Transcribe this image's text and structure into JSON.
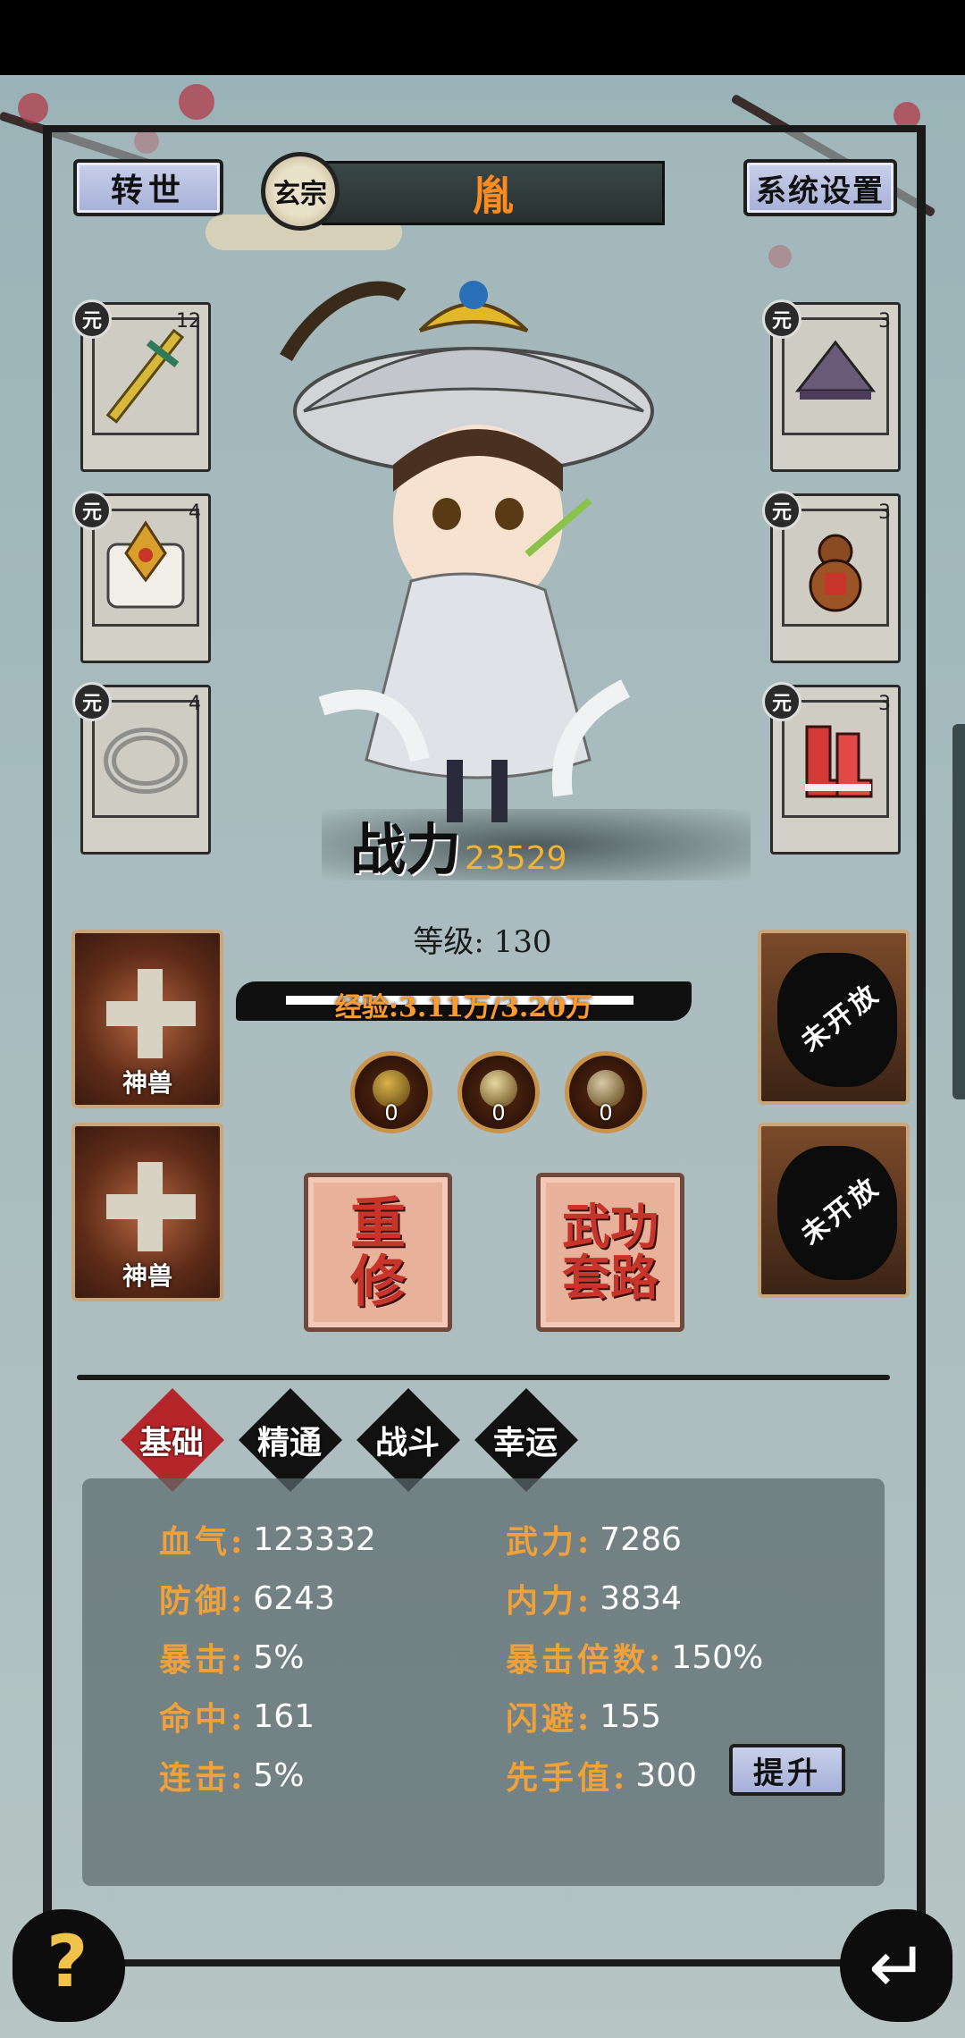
{
  "header": {
    "rebirth_label": "转世",
    "sect_badge": "玄宗",
    "player_name": "胤",
    "settings_label": "系统设置"
  },
  "equipment_left": [
    {
      "name": "sword",
      "grade": "元",
      "level": "12"
    },
    {
      "name": "armor-pauldron",
      "grade": "元",
      "level": "4"
    },
    {
      "name": "ring",
      "grade": "元",
      "level": "4"
    }
  ],
  "equipment_right": [
    {
      "name": "hat",
      "grade": "元",
      "level": "3"
    },
    {
      "name": "gourd",
      "grade": "元",
      "level": "3"
    },
    {
      "name": "boots",
      "grade": "元",
      "level": "3"
    }
  ],
  "character": {
    "power_label": "战力",
    "power_value": "23529",
    "level_text": "等级: 130",
    "exp_text": "经验:3.11万/3.20万",
    "exp_progress": 0.972
  },
  "beast_slots": [
    {
      "label": "神兽"
    },
    {
      "label": "神兽"
    }
  ],
  "locked_slots": [
    {
      "label": "未开放"
    },
    {
      "label": "未开放"
    }
  ],
  "orbs": [
    {
      "count": "0",
      "color": "#d9b24a"
    },
    {
      "count": "0",
      "color": "#e8d7a0"
    },
    {
      "count": "0",
      "color": "#d6c8a6"
    }
  ],
  "actions": {
    "retrain_line1": "重",
    "retrain_line2": "修",
    "martial_line1": "武功",
    "martial_line2": "套路"
  },
  "tabs": [
    {
      "label": "基础",
      "active": true
    },
    {
      "label": "精通",
      "active": false
    },
    {
      "label": "战斗",
      "active": false
    },
    {
      "label": "幸运",
      "active": false
    }
  ],
  "stats": {
    "hp": {
      "label": "血气:",
      "value": "123332"
    },
    "attack": {
      "label": "武力:",
      "value": "7286"
    },
    "defense": {
      "label": "防御:",
      "value": "6243"
    },
    "inner": {
      "label": "内力:",
      "value": "3834"
    },
    "crit": {
      "label": "暴击:",
      "value": "5%"
    },
    "crit_mult": {
      "label": "暴击倍数:",
      "value": "150%"
    },
    "hit": {
      "label": "命中:",
      "value": "161"
    },
    "dodge": {
      "label": "闪避:",
      "value": "155"
    },
    "combo": {
      "label": "连击:",
      "value": "5%"
    },
    "initiative": {
      "label": "先手值:",
      "value": "300"
    }
  },
  "upgrade_label": "提升",
  "help_label": "?",
  "back_label": "↵",
  "colors": {
    "accent_orange": "#f0a13a",
    "name_orange": "#ff8a1e",
    "tab_active": "#b5262a",
    "power_gold": "#f2b233"
  }
}
